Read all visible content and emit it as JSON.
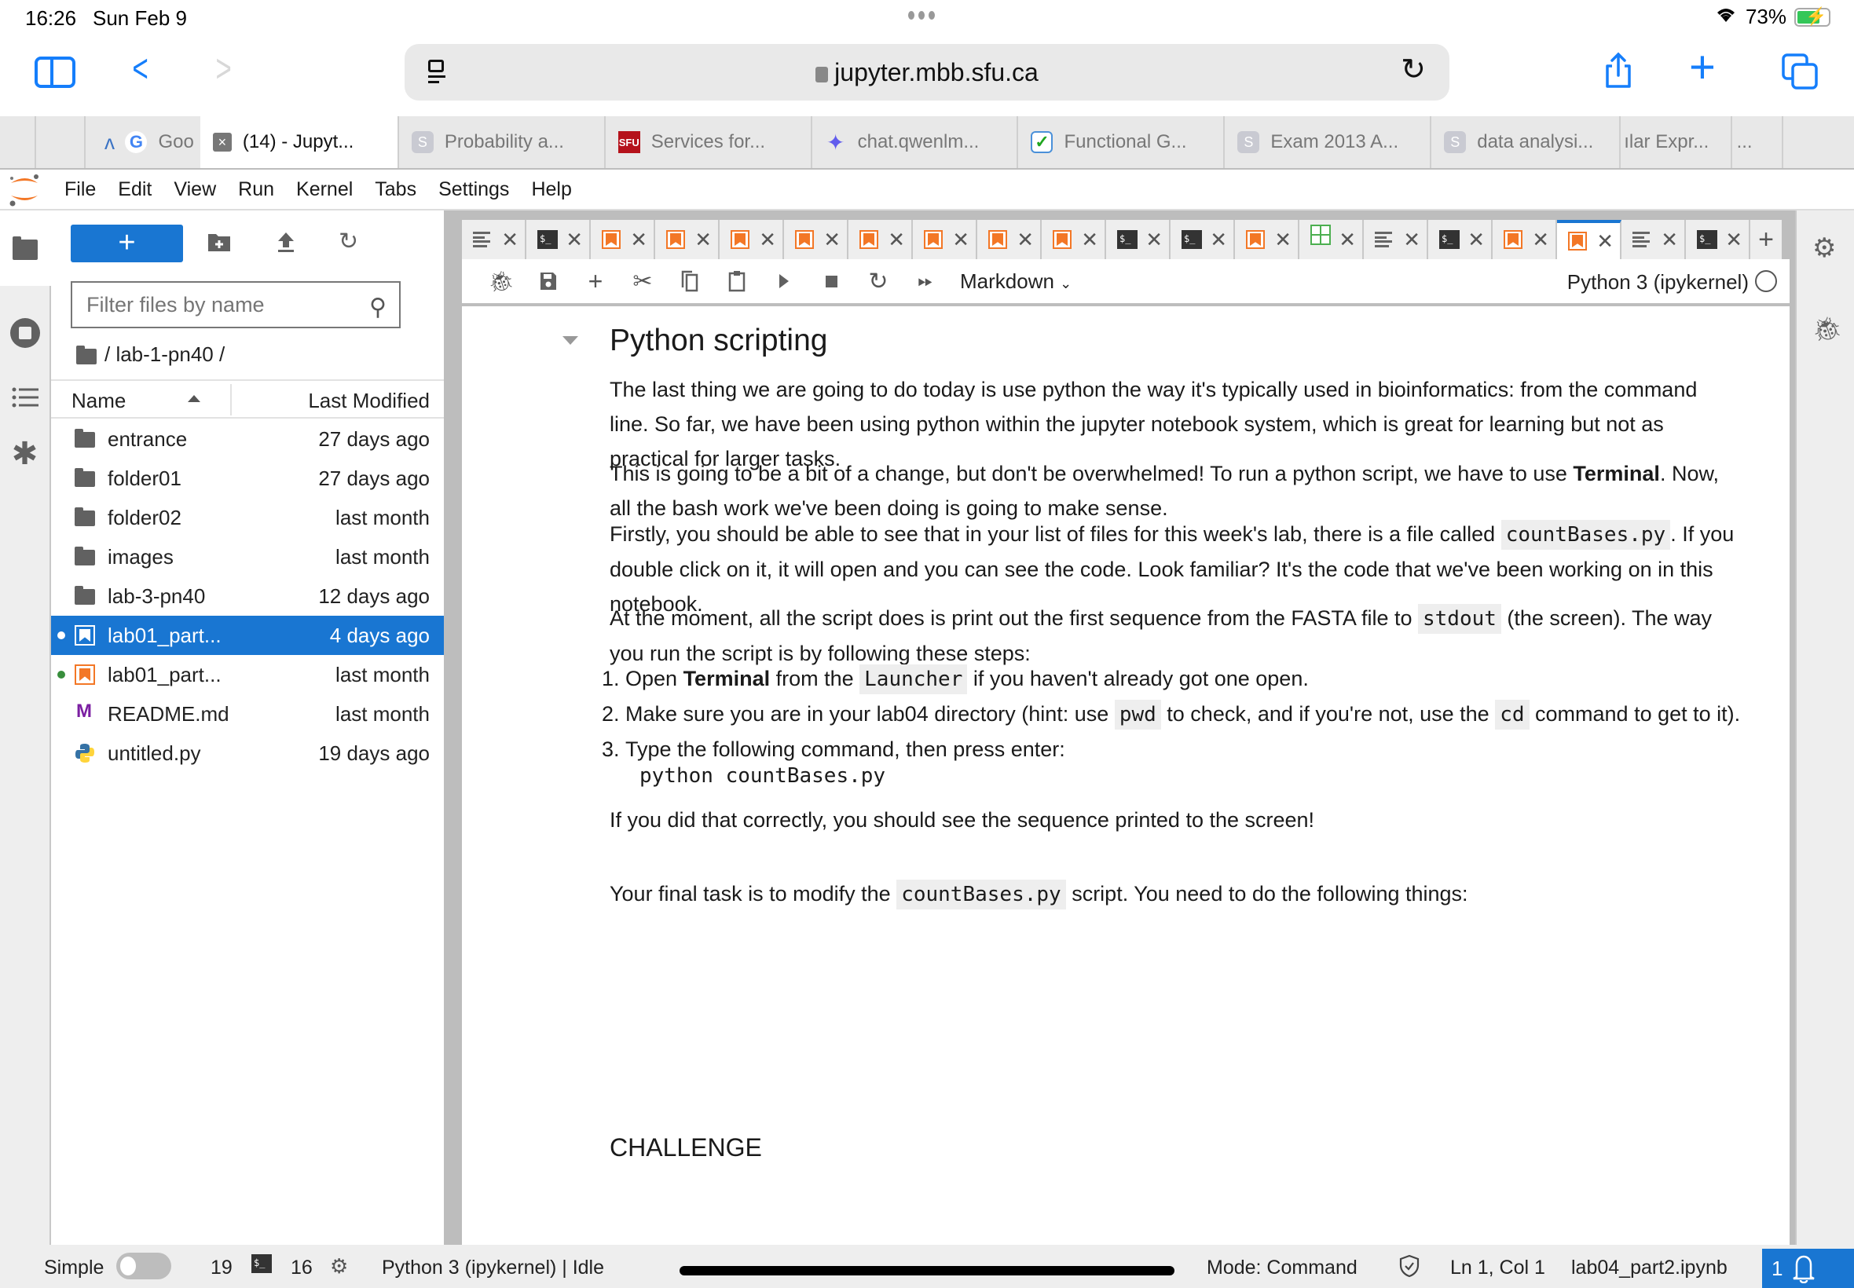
{
  "ios_status": {
    "time": "16:26",
    "date": "Sun Feb 9",
    "battery": "73%"
  },
  "safari": {
    "url": "jupyter.mbb.sfu.ca",
    "tabs": [
      {
        "label": "",
        "icon": "pinned-tab"
      },
      {
        "label": "",
        "icon": "pinned-tab"
      },
      {
        "label": "Goo",
        "icon": "google-icon"
      },
      {
        "label": "(14) - Jupyt...",
        "icon": "close-icon",
        "active": true
      },
      {
        "label": "Probability a...",
        "icon": "s-icon"
      },
      {
        "label": "Services for...",
        "icon": "sfu-icon"
      },
      {
        "label": "chat.qwenlm...",
        "icon": "qwen-icon"
      },
      {
        "label": "Functional G...",
        "icon": "check-icon"
      },
      {
        "label": "Exam 2013 A...",
        "icon": "s-icon"
      },
      {
        "label": "data analysi...",
        "icon": "s-icon"
      },
      {
        "label": "ılar Expr...",
        "icon": ""
      },
      {
        "label": "...",
        "icon": ""
      }
    ]
  },
  "menu": [
    "File",
    "Edit",
    "View",
    "Run",
    "Kernel",
    "Tabs",
    "Settings",
    "Help"
  ],
  "filebrowser": {
    "filter_placeholder": "Filter files by name",
    "breadcrumb": "/ lab-1-pn40 /",
    "col_name": "Name",
    "col_modified": "Last Modified",
    "files": [
      {
        "name": "entrance",
        "modified": "27 days ago",
        "type": "folder"
      },
      {
        "name": "folder01",
        "modified": "27 days ago",
        "type": "folder"
      },
      {
        "name": "folder02",
        "modified": "last month",
        "type": "folder"
      },
      {
        "name": "images",
        "modified": "last month",
        "type": "folder"
      },
      {
        "name": "lab-3-pn40",
        "modified": "12 days ago",
        "type": "folder"
      },
      {
        "name": "lab01_part...",
        "modified": "4 days ago",
        "type": "notebook",
        "selected": true,
        "running": true
      },
      {
        "name": "lab01_part...",
        "modified": "last month",
        "type": "notebook",
        "running": true
      },
      {
        "name": "README.md",
        "modified": "last month",
        "type": "markdown"
      },
      {
        "name": "untitled.py",
        "modified": "19 days ago",
        "type": "python"
      }
    ]
  },
  "doc_tabs": [
    "text",
    "terminal",
    "notebook",
    "notebook",
    "notebook",
    "notebook",
    "notebook",
    "notebook",
    "notebook",
    "notebook",
    "terminal",
    "terminal",
    "notebook",
    "spreadsheet",
    "text",
    "terminal",
    "notebook",
    "notebook-active",
    "text",
    "terminal"
  ],
  "toolbar": {
    "cell_type": "Markdown",
    "kernel": "Python 3 (ipykernel)"
  },
  "notebook": {
    "heading": "Python scripting",
    "p1": "The last thing we are going to do today is use python the way it's typically used in bioinformatics: from the command line. So far, we have been using python within the jupyter notebook system, which is great for learning but not as practical for larger tasks.",
    "p2_pre": "This is going to be a bit of a change, but don't be overwhelmed! To run a python script, we have to use ",
    "p2_bold": "Terminal",
    "p2_post": ". Now, all the bash work we've been doing is going to make sense.",
    "p3_pre": "Firstly, you should be able to see that in your list of files for this week's lab, there is a file called ",
    "p3_code": "countBases.py",
    "p3_post": ". If you double click on it, it will open and you can see the code. Look familiar? It's the code that we've been working on in this notebook.",
    "p4_pre": "At the moment, all the script does is print out the first sequence from the FASTA file to ",
    "p4_code": "stdout",
    "p4_post": " (the screen). The way you run the script is by following these steps:",
    "step1_a": "Open ",
    "step1_bold": "Terminal",
    "step1_b": " from the ",
    "step1_code": "Launcher",
    "step1_c": " if you haven't already got one open.",
    "step2_a": "Make sure you are in your lab04 directory (hint: use ",
    "step2_code1": "pwd",
    "step2_b": " to check, and if you're not, use the ",
    "step2_code2": "cd",
    "step2_c": " command to get to it).",
    "step3": "Type the following command, then press enter:",
    "command": "python countBases.py",
    "p5": "If you did that correctly, you should see the sequence printed to the screen!",
    "h3": "CHALLENGE",
    "p6_pre": "Your final task is to modify the ",
    "p6_code": "countBases.py",
    "p6_post": " script. You need to do the following things:"
  },
  "statusbar": {
    "mode_label": "Simple",
    "terminals": "19",
    "kernels": "16",
    "kernel_status": "Python 3 (ipykernel) | Idle",
    "mode": "Mode: Command",
    "cursor": "Ln 1, Col 1",
    "filename": "lab04_part2.ipynb",
    "notifications": "1"
  }
}
